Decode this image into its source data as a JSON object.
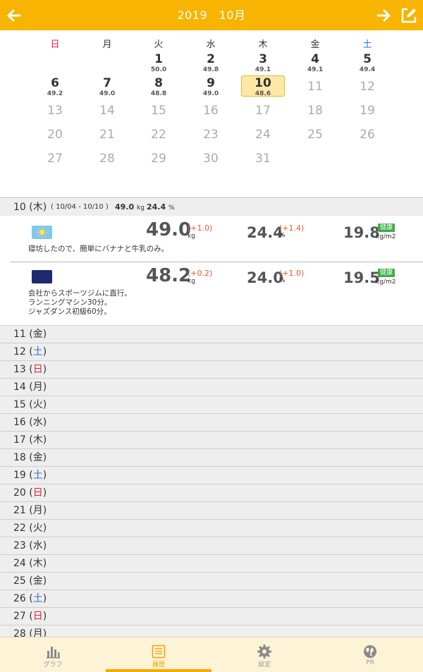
{
  "header": {
    "title": "2019　10月"
  },
  "calendar": {
    "weekdays": [
      "日",
      "月",
      "火",
      "水",
      "木",
      "金",
      "土"
    ],
    "rows": [
      [
        null,
        null,
        {
          "d": "1",
          "w": "50.0"
        },
        {
          "d": "2",
          "w": "49.8"
        },
        {
          "d": "3",
          "w": "49.1"
        },
        {
          "d": "4",
          "w": "49.1"
        },
        {
          "d": "5",
          "w": "49.4"
        }
      ],
      [
        {
          "d": "6",
          "w": "49.2"
        },
        {
          "d": "7",
          "w": "49.0"
        },
        {
          "d": "8",
          "w": "48.8"
        },
        {
          "d": "9",
          "w": "49.0"
        },
        {
          "d": "10",
          "w": "48.6",
          "today": true
        },
        {
          "d": "11",
          "future": true
        },
        {
          "d": "12",
          "future": true
        }
      ],
      [
        {
          "d": "13",
          "future": true
        },
        {
          "d": "14",
          "future": true
        },
        {
          "d": "15",
          "future": true
        },
        {
          "d": "16",
          "future": true
        },
        {
          "d": "17",
          "future": true
        },
        {
          "d": "18",
          "future": true
        },
        {
          "d": "19",
          "future": true
        }
      ],
      [
        {
          "d": "20",
          "future": true
        },
        {
          "d": "21",
          "future": true
        },
        {
          "d": "22",
          "future": true
        },
        {
          "d": "23",
          "future": true
        },
        {
          "d": "24",
          "future": true
        },
        {
          "d": "25",
          "future": true
        },
        {
          "d": "26",
          "future": true
        }
      ],
      [
        {
          "d": "27",
          "future": true
        },
        {
          "d": "28",
          "future": true
        },
        {
          "d": "29",
          "future": true
        },
        {
          "d": "30",
          "future": true
        },
        {
          "d": "31",
          "future": true
        },
        null,
        null
      ]
    ]
  },
  "summary": {
    "day": "10 (木)",
    "range": "( 10/04 - 10/10 )",
    "avg_weight": "49.0",
    "avg_weight_unit": "kg",
    "avg_fat": "24.4",
    "avg_fat_unit": "%"
  },
  "entries": [
    {
      "icon": "sun-icon",
      "weight": "49.0",
      "weight_delta": "(+1.0)",
      "weight_unit": "kg",
      "fat": "24.4",
      "fat_delta": "(+1.4)",
      "fat_unit": "%",
      "bmi": "19.8",
      "bmi_badge": "健康",
      "bmi_unit": "kg/m2",
      "note": "寝坊したので、簡単にバナナと牛乳のみ。"
    },
    {
      "icon": "moon-icon",
      "weight": "48.2",
      "weight_delta": "(+0.2)",
      "weight_unit": "kg",
      "fat": "24.0",
      "fat_delta": "(+1.0)",
      "fat_unit": "%",
      "bmi": "19.5",
      "bmi_badge": "健康",
      "bmi_unit": "kg/m2",
      "note": "会社からスポーツジムに直行。\nランニングマシン30分。\nジャズダンス初級60分。"
    }
  ],
  "days": [
    {
      "num": "11",
      "dow": "金",
      "color": ""
    },
    {
      "num": "12",
      "dow": "土",
      "color": "blue"
    },
    {
      "num": "13",
      "dow": "日",
      "color": "red"
    },
    {
      "num": "14",
      "dow": "月",
      "color": ""
    },
    {
      "num": "15",
      "dow": "火",
      "color": ""
    },
    {
      "num": "16",
      "dow": "水",
      "color": ""
    },
    {
      "num": "17",
      "dow": "木",
      "color": ""
    },
    {
      "num": "18",
      "dow": "金",
      "color": ""
    },
    {
      "num": "19",
      "dow": "土",
      "color": "blue"
    },
    {
      "num": "20",
      "dow": "日",
      "color": "red"
    },
    {
      "num": "21",
      "dow": "月",
      "color": ""
    },
    {
      "num": "22",
      "dow": "火",
      "color": ""
    },
    {
      "num": "23",
      "dow": "水",
      "color": ""
    },
    {
      "num": "24",
      "dow": "木",
      "color": ""
    },
    {
      "num": "25",
      "dow": "金",
      "color": ""
    },
    {
      "num": "26",
      "dow": "土",
      "color": "blue"
    },
    {
      "num": "27",
      "dow": "日",
      "color": "red"
    },
    {
      "num": "28",
      "dow": "月",
      "color": ""
    }
  ],
  "tabs": [
    {
      "label": "グラフ",
      "icon": "bar-chart-icon",
      "active": false
    },
    {
      "label": "履歴",
      "icon": "list-icon",
      "active": true
    },
    {
      "label": "設定",
      "icon": "gear-icon",
      "active": false
    },
    {
      "label": "PR",
      "icon": "globe-icon",
      "active": false
    }
  ],
  "colors": {
    "accent": "#f7b400",
    "sunday": "#e0213f",
    "saturday": "#2b6fd6",
    "delta": "#e4572e",
    "badge": "#3fae49"
  }
}
